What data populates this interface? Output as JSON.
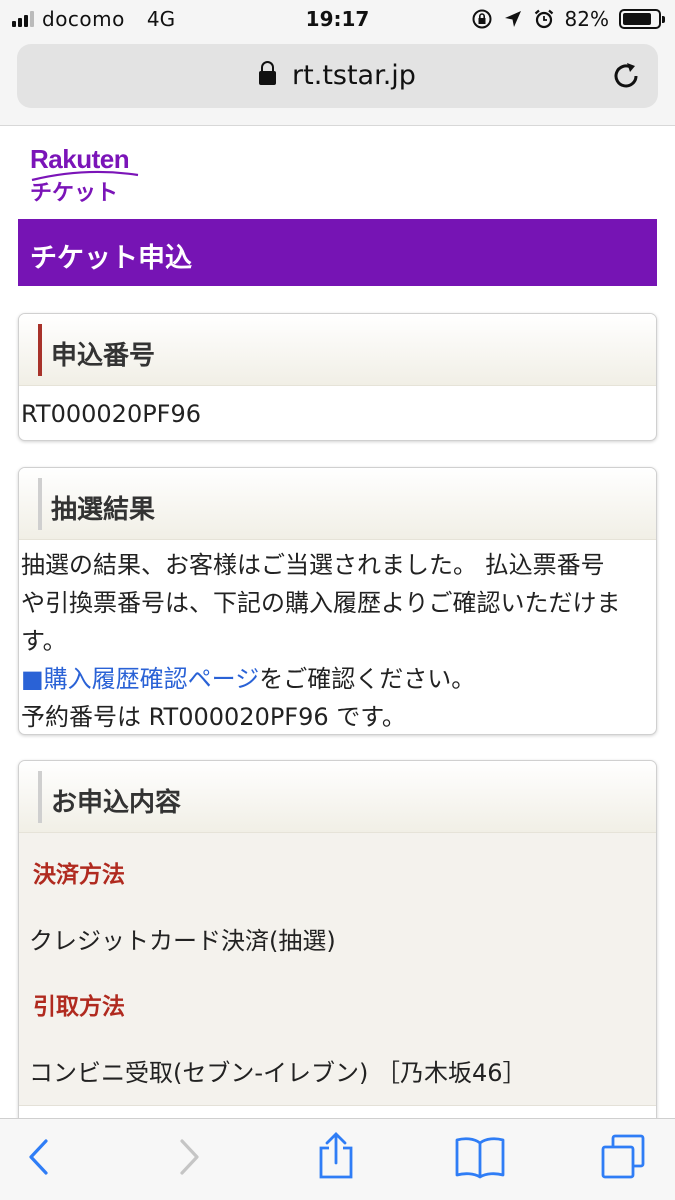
{
  "status_bar": {
    "carrier": "docomo",
    "network": "4G",
    "time": "19:17",
    "battery": "82%",
    "battery_level": 0.82
  },
  "browser": {
    "url": "rt.tstar.jp"
  },
  "logo": {
    "line1": "Rakuten",
    "line2": "チケット",
    "color": "#7b14b8"
  },
  "page": {
    "title": "チケット申込",
    "title_bg": "#7614b4"
  },
  "application_number": {
    "heading": "申込番号",
    "value": "RT000020PF96",
    "accent": "#a8322a"
  },
  "lottery_result": {
    "heading": "抽選結果",
    "line1": "抽選の結果、お客様はご当選されました。 払込票番号",
    "line2": "や引換票番号は、下記の購入履歴よりご確認いただけま",
    "line3": "す。",
    "link_text": "■購入履歴確認ページ",
    "after_link": "をご確認ください。",
    "reservation": "予約番号は RT000020PF96 です。"
  },
  "application_details": {
    "heading": "お申込内容",
    "payment_label": "決済方法",
    "payment_value": "クレジットカード決済(抽選)",
    "pickup_label": "引取方法",
    "pickup_value": "コンビニ受取(セブン-イレブン) ［乃木坂46］"
  },
  "toolbar": {
    "icons": [
      "back-icon",
      "forward-icon",
      "share-icon",
      "bookmarks-icon",
      "tabs-icon"
    ]
  }
}
